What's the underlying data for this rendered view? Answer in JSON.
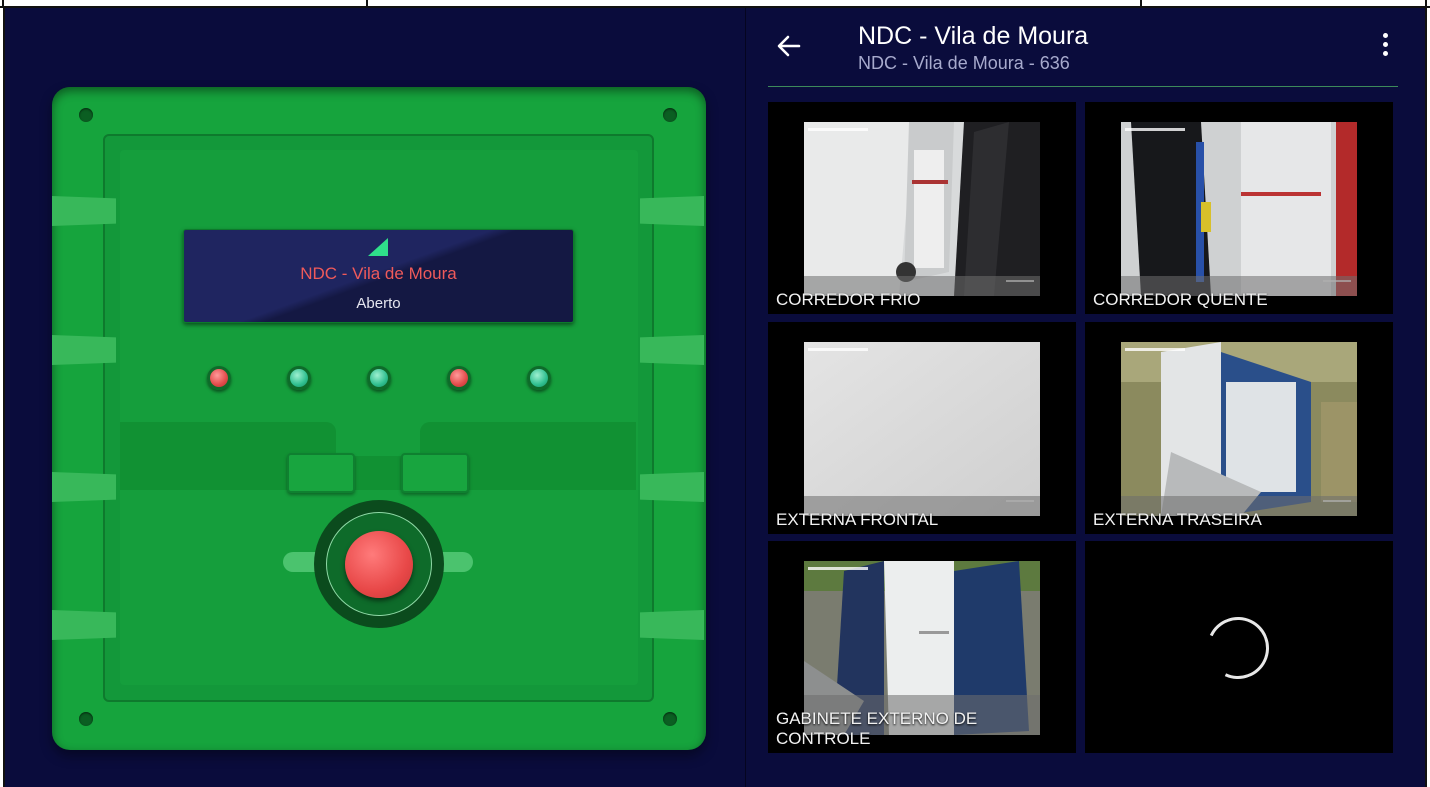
{
  "panel": {
    "device_name": "NDC - Vila de Moura",
    "status": "Aberto",
    "leds": [
      "red",
      "green",
      "green",
      "red",
      "green"
    ],
    "colors": {
      "panel": "#16a43d",
      "led_red": "#e24a4a",
      "led_green": "#2fbf8f",
      "trigger": "#e84848"
    }
  },
  "header": {
    "back_icon": "arrow-left-icon",
    "title": "NDC - Vila de Moura",
    "subtitle": "NDC - Vila de Moura - 636",
    "menu_icon": "more-vertical-icon"
  },
  "cameras": [
    {
      "label": "CORREDOR FRIO"
    },
    {
      "label": "CORREDOR QUENTE"
    },
    {
      "label": "EXTERNA FRONTAL"
    },
    {
      "label": "EXTERNA TRASEIRA"
    },
    {
      "label": "GABINETE EXTERNO DE CONTROLE"
    }
  ],
  "loading_tile": {
    "icon": "loading-spinner-icon"
  }
}
